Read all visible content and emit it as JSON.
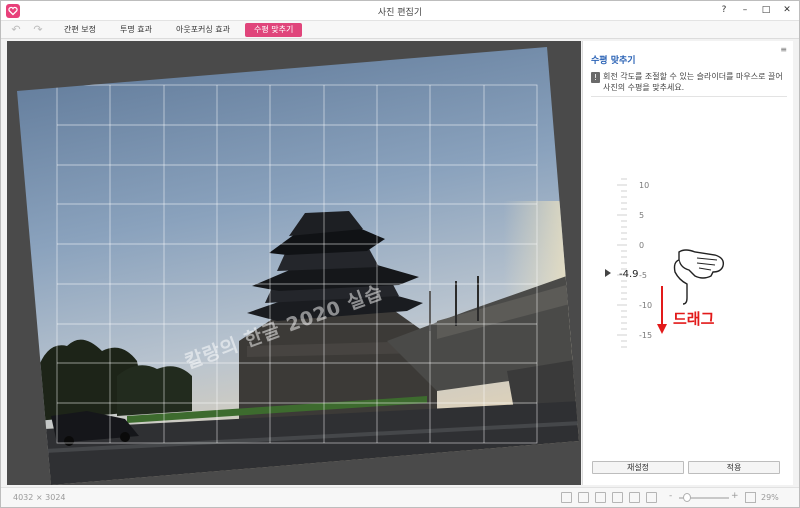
{
  "window": {
    "title": "사진 편집기",
    "controls": {
      "help": "?",
      "minimize": "–",
      "maximize": "□",
      "close": "✕"
    }
  },
  "toolbar": {
    "undo_icon": "undo-icon",
    "redo_icon": "redo-icon",
    "tabs": [
      {
        "label": "간편 보정",
        "active": false
      },
      {
        "label": "투명 효과",
        "active": false
      },
      {
        "label": "아웃포커싱 효과",
        "active": false
      },
      {
        "label": "수평 맞추기",
        "active": true
      }
    ]
  },
  "panel": {
    "title": "수평 맞추기",
    "menu_icon": "≡",
    "tip": "회전 각도를 조절할 수 있는 슬라이더를 마우스로 끌어 사진의 수평을 맞추세요.",
    "ruler": {
      "labels": [
        "10",
        "5",
        "0",
        "-5",
        "-10",
        "-15"
      ],
      "current_value": "-4.9",
      "min": -15,
      "max": 10
    },
    "reset_label": "재설정",
    "apply_label": "적용"
  },
  "annotation": {
    "watermark": "칼랑의 한글 2020 실습",
    "drag_label": "드래그",
    "accent_color": "#e21a1a"
  },
  "statusbar": {
    "image_size": "4032 × 3024",
    "zoom_minus": "-",
    "zoom_plus": "+",
    "zoom_value": "29%"
  },
  "colors": {
    "accent": "#e0457b",
    "panel_title": "#2a62b5",
    "canvas_bg": "#4a4a4a"
  }
}
